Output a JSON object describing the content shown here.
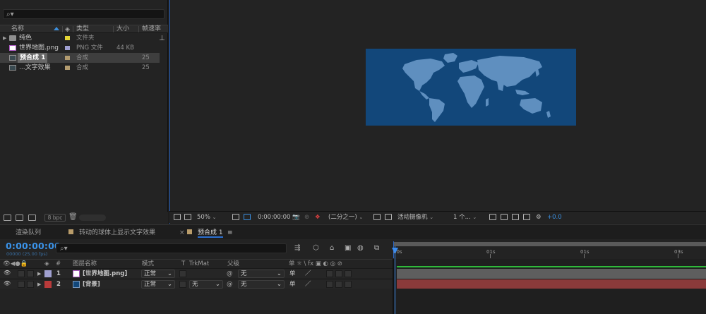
{
  "project": {
    "search_placeholder": "⌕▾",
    "columns": {
      "name": "名称",
      "type": "类型",
      "size": "大小",
      "framerate": "帧速率"
    },
    "items": [
      {
        "name": "纯色",
        "type": "文件夹",
        "size": "",
        "fps": "",
        "icon": "folder-icon",
        "label_color": "#e3d535",
        "expandable": true
      },
      {
        "name": "世界地图.png",
        "type": "PNG 文件",
        "size": "44 KB",
        "fps": "",
        "icon": "png-file-icon",
        "label_color": "#a0a0d0",
        "expandable": false
      },
      {
        "name": "预合成 1",
        "type": "合成",
        "size": "",
        "fps": "25",
        "icon": "composition-icon",
        "label_color": "#b39c70",
        "expandable": false,
        "selected": true
      },
      {
        "name": "...文字效果",
        "type": "合成",
        "size": "",
        "fps": "25",
        "icon": "composition-icon",
        "label_color": "#b39c70",
        "expandable": false
      }
    ],
    "bpc": "8 bpc"
  },
  "viewer": {
    "zoom": "50%",
    "timecode": "0:00:00:00",
    "resolution": "(二分之一)",
    "camera": "活动摄像机",
    "views": "1 个...",
    "exposure": "+0.0"
  },
  "tabs": [
    {
      "label": "渲染队列"
    },
    {
      "label": "转动的球体上显示文字效果"
    },
    {
      "label": "预合成 1"
    }
  ],
  "timeline": {
    "timecode": "0:00:00:00",
    "fps": "00000 (25.00 fps)",
    "search_placeholder": "⌕▾",
    "columns": {
      "num": "#",
      "layer_name": "图层名称",
      "mode": "模式",
      "t": "T",
      "trkmat": "TrkMat",
      "parent": "父级",
      "switches": "单 ☼ \\ fx ▣ ◐ ◎ ⊘"
    },
    "ruler": {
      "ticks": [
        "00s",
        "01s",
        "01s",
        "03s"
      ]
    },
    "layers": [
      {
        "num": "1",
        "name": "[世界地图.png]",
        "mode": "正常",
        "trkmat": "",
        "parent": "无",
        "label_color": "#a0a0d0",
        "icon": "png-file-icon"
      },
      {
        "num": "2",
        "name": "[背景]",
        "mode": "正常",
        "trkmat": "无",
        "parent": "无",
        "label_color": "#b83a3a",
        "icon": "solid-layer-icon"
      }
    ]
  },
  "colors": {
    "accent": "#3a92e8",
    "map_background": "#12477a",
    "land": "#5f8fbf"
  }
}
